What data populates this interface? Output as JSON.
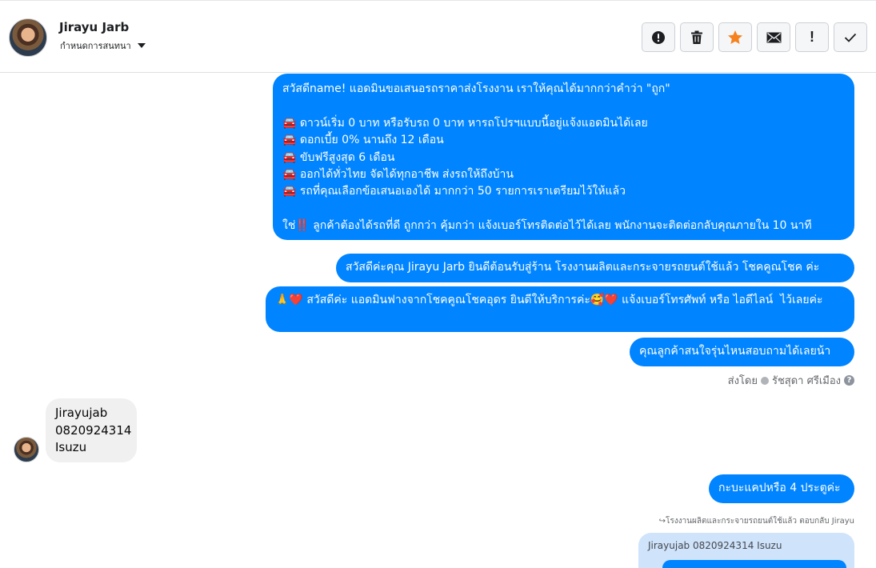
{
  "header": {
    "contact_name": "Jirayu Jarb",
    "contact_sub": "กำหนดการสนทนา",
    "toolbar": [
      {
        "name": "report-button",
        "icon": "alert-circle-icon"
      },
      {
        "name": "delete-button",
        "icon": "trash-icon"
      },
      {
        "name": "star-button",
        "icon": "star-icon"
      },
      {
        "name": "mark-unread-button",
        "icon": "envelope-icon"
      },
      {
        "name": "important-button",
        "icon": "exclamation-icon",
        "text": "!"
      },
      {
        "name": "done-button",
        "icon": "check-icon"
      }
    ]
  },
  "messages": {
    "m1": "สวัสดีname! แอดมินขอเสนอรถราคาส่งโรงงาน เราให้คุณได้มากกว่าคำว่า \"ถูก\"\n\n🚘 ดาวน์เริ่ม 0 บาท หรือรับรถ 0 บาท หารถโปรฯแบบนี้อยู่แจ้งแอดมินได้เลย\n🚘 ดอกเบี้ย 0% นานถึง 12 เดือน\n🚘 ขับฟรีสูงสุด 6 เดือน\n🚘 ออกได้ทั่วไทย จัดได้ทุกอาชีพ ส่งรถให้ถึงบ้าน\n🚘 รถที่คุณเลือกข้อเสนอเองได้ มากกว่า 50 รายการเราเตรียมไว้ให้แล้ว\n\nใช่‼️ ลูกค้าต้องได้รถที่ดี ถูกกว่า คุ้มกว่า แจ้งเบอร์โทรติดต่อไว้ได้เลย พนักงานจะติดต่อกลับคุณภายใน 10 นาที",
    "m2": "สวัสดีค่ะคุณ Jirayu Jarb ยินดีต้อนรับสู่ร้าน โรงงานผลิตและกระจายรถยนต์ใช้แล้ว โชคคูณโชค ค่ะ",
    "m3": "🙏❤️ สวัสดีค่ะ แอดมินฟางจากโชคคูณโชคอุดร ยินดีให้บริการค่ะ🥰❤️ แจ้งเบอร์โทรศัพท์ หรือ ไอดีไลน์  ไว้เลยค่ะ",
    "m4": "คุณลูกค้าสนใจรุ่นไหนสอบถามได้เลยน้า",
    "sent_by_prefix": "ส่งโดย",
    "sent_by_name": "รัชสุดา ศรีเมือง",
    "help": "?",
    "incoming": "Jirayujab\n0820924314\nIsuzu",
    "m5": "กะบะแคปหรือ 4 ประตูค่ะ",
    "reply_note": "↪โรงงานผลิตและกระจายรถยนต์ใช้แล้ว ตอบกลับ Jirayu",
    "reply_quote": "Jirayujab 0820924314 Isuzu"
  },
  "colors": {
    "outgoing_bubble": "#0084ff",
    "incoming_bubble": "#f0f0f0",
    "star_accent": "#f5821f"
  }
}
